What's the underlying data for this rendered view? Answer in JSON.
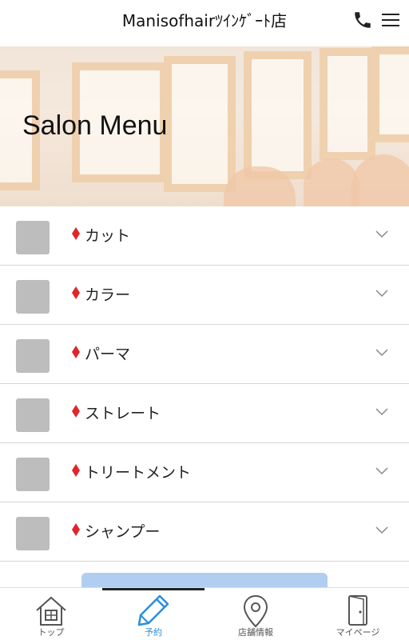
{
  "header": {
    "title": "Manisofhairﾂｲﾝｹﾞｰﾄ店",
    "phone_icon": "phone-icon",
    "menu_icon": "hamburger-menu-icon"
  },
  "hero": {
    "heading": "Salon Menu"
  },
  "menu": {
    "items": [
      {
        "label": "カット"
      },
      {
        "label": "カラー"
      },
      {
        "label": "パーマ"
      },
      {
        "label": "ストレート"
      },
      {
        "label": "トリートメント"
      },
      {
        "label": "シャンプー"
      }
    ],
    "bullet_color": "#e0262b"
  },
  "tabs": [
    {
      "label": "トップ",
      "icon": "home-icon"
    },
    {
      "label": "予約",
      "icon": "pencil-icon",
      "active": true
    },
    {
      "label": "店舗情報",
      "icon": "location-pin-icon"
    },
    {
      "label": "マイページ",
      "icon": "door-icon"
    }
  ],
  "colors": {
    "accent": "#2a8ee0",
    "cta": "#a8c9ef"
  }
}
